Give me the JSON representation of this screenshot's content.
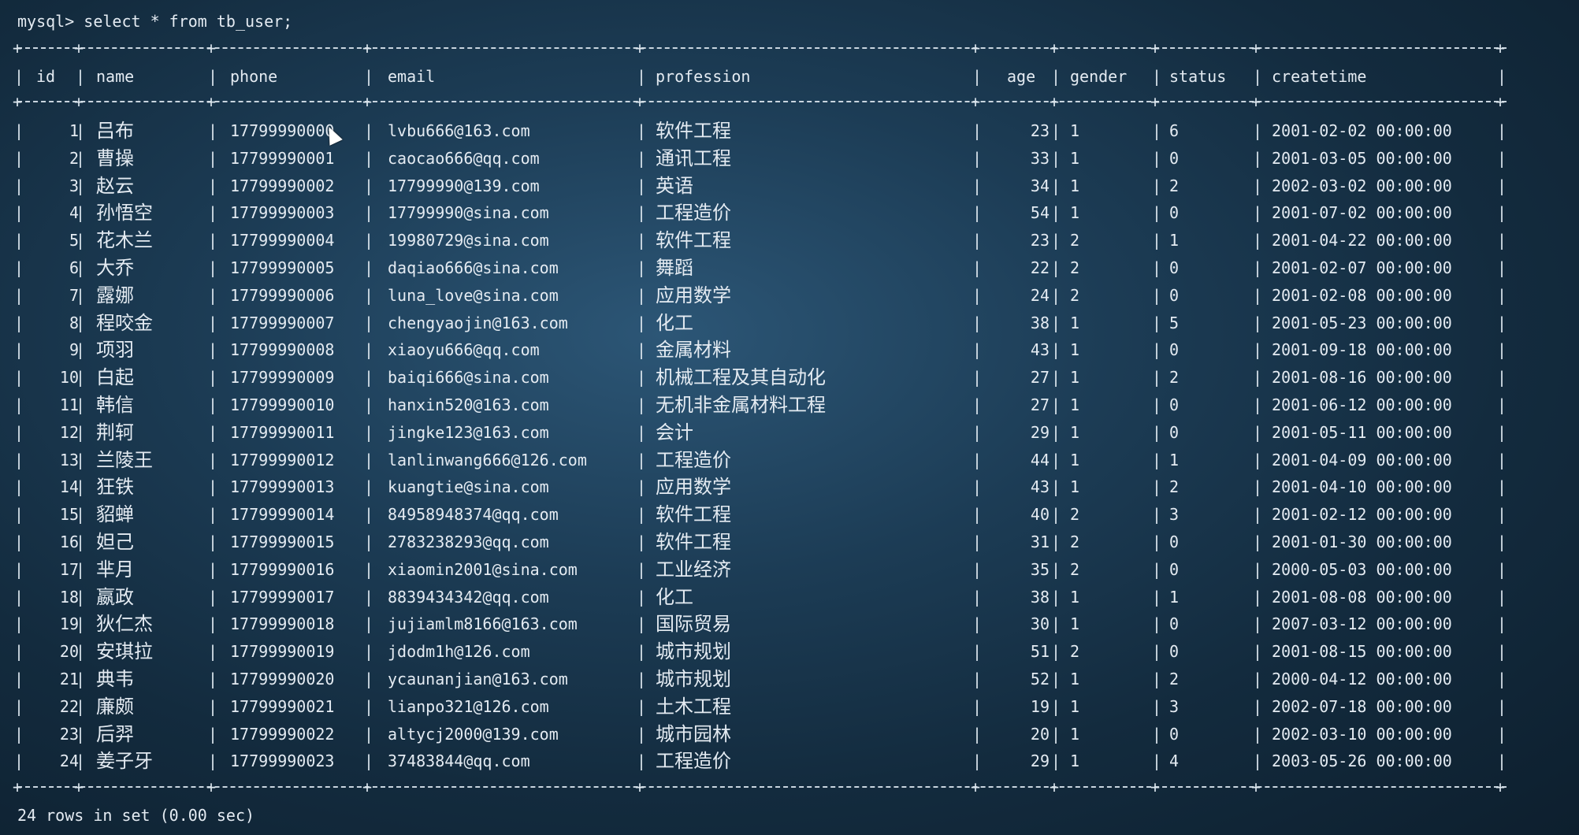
{
  "terminal": {
    "prompt": "mysql> select * from tb_user;",
    "footer": "24 rows in set (0.00 sec)"
  },
  "table": {
    "columns": [
      "id",
      "name",
      "phone",
      "email",
      "profession",
      "age",
      "gender",
      "status",
      "createtime"
    ],
    "rows": [
      [
        "1",
        "吕布",
        "17799990000",
        "lvbu666@163.com",
        "软件工程",
        "23",
        "1",
        "6",
        "2001-02-02 00:00:00"
      ],
      [
        "2",
        "曹操",
        "17799990001",
        "caocao666@qq.com",
        "通讯工程",
        "33",
        "1",
        "0",
        "2001-03-05 00:00:00"
      ],
      [
        "3",
        "赵云",
        "17799990002",
        "17799990@139.com",
        "英语",
        "34",
        "1",
        "2",
        "2002-03-02 00:00:00"
      ],
      [
        "4",
        "孙悟空",
        "17799990003",
        "17799990@sina.com",
        "工程造价",
        "54",
        "1",
        "0",
        "2001-07-02 00:00:00"
      ],
      [
        "5",
        "花木兰",
        "17799990004",
        "19980729@sina.com",
        "软件工程",
        "23",
        "2",
        "1",
        "2001-04-22 00:00:00"
      ],
      [
        "6",
        "大乔",
        "17799990005",
        "daqiao666@sina.com",
        "舞蹈",
        "22",
        "2",
        "0",
        "2001-02-07 00:00:00"
      ],
      [
        "7",
        "露娜",
        "17799990006",
        "luna_love@sina.com",
        "应用数学",
        "24",
        "2",
        "0",
        "2001-02-08 00:00:00"
      ],
      [
        "8",
        "程咬金",
        "17799990007",
        "chengyaojin@163.com",
        "化工",
        "38",
        "1",
        "5",
        "2001-05-23 00:00:00"
      ],
      [
        "9",
        "项羽",
        "17799990008",
        "xiaoyu666@qq.com",
        "金属材料",
        "43",
        "1",
        "0",
        "2001-09-18 00:00:00"
      ],
      [
        "10",
        "白起",
        "17799990009",
        "baiqi666@sina.com",
        "机械工程及其自动化",
        "27",
        "1",
        "2",
        "2001-08-16 00:00:00"
      ],
      [
        "11",
        "韩信",
        "17799990010",
        "hanxin520@163.com",
        "无机非金属材料工程",
        "27",
        "1",
        "0",
        "2001-06-12 00:00:00"
      ],
      [
        "12",
        "荆轲",
        "17799990011",
        "jingke123@163.com",
        "会计",
        "29",
        "1",
        "0",
        "2001-05-11 00:00:00"
      ],
      [
        "13",
        "兰陵王",
        "17799990012",
        "lanlinwang666@126.com",
        "工程造价",
        "44",
        "1",
        "1",
        "2001-04-09 00:00:00"
      ],
      [
        "14",
        "狂铁",
        "17799990013",
        "kuangtie@sina.com",
        "应用数学",
        "43",
        "1",
        "2",
        "2001-04-10 00:00:00"
      ],
      [
        "15",
        "貂蝉",
        "17799990014",
        "84958948374@qq.com",
        "软件工程",
        "40",
        "2",
        "3",
        "2001-02-12 00:00:00"
      ],
      [
        "16",
        "妲己",
        "17799990015",
        "2783238293@qq.com",
        "软件工程",
        "31",
        "2",
        "0",
        "2001-01-30 00:00:00"
      ],
      [
        "17",
        "芈月",
        "17799990016",
        "xiaomin2001@sina.com",
        "工业经济",
        "35",
        "2",
        "0",
        "2000-05-03 00:00:00"
      ],
      [
        "18",
        "嬴政",
        "17799990017",
        "8839434342@qq.com",
        "化工",
        "38",
        "1",
        "1",
        "2001-08-08 00:00:00"
      ],
      [
        "19",
        "狄仁杰",
        "17799990018",
        "jujiamlm8166@163.com",
        "国际贸易",
        "30",
        "1",
        "0",
        "2007-03-12 00:00:00"
      ],
      [
        "20",
        "安琪拉",
        "17799990019",
        "jdodm1h@126.com",
        "城市规划",
        "51",
        "2",
        "0",
        "2001-08-15 00:00:00"
      ],
      [
        "21",
        "典韦",
        "17799990020",
        "ycaunanjian@163.com",
        "城市规划",
        "52",
        "1",
        "2",
        "2000-04-12 00:00:00"
      ],
      [
        "22",
        "廉颇",
        "17799990021",
        "lianpo321@126.com",
        "土木工程",
        "19",
        "1",
        "3",
        "2002-07-18 00:00:00"
      ],
      [
        "23",
        "后羿",
        "17799990022",
        "altycj2000@139.com",
        "城市园林",
        "20",
        "1",
        "0",
        "2002-03-10 00:00:00"
      ],
      [
        "24",
        "姜子牙",
        "17799990023",
        "37483844@qq.com",
        "工程造价",
        "29",
        "1",
        "4",
        "2003-05-26 00:00:00"
      ]
    ]
  }
}
